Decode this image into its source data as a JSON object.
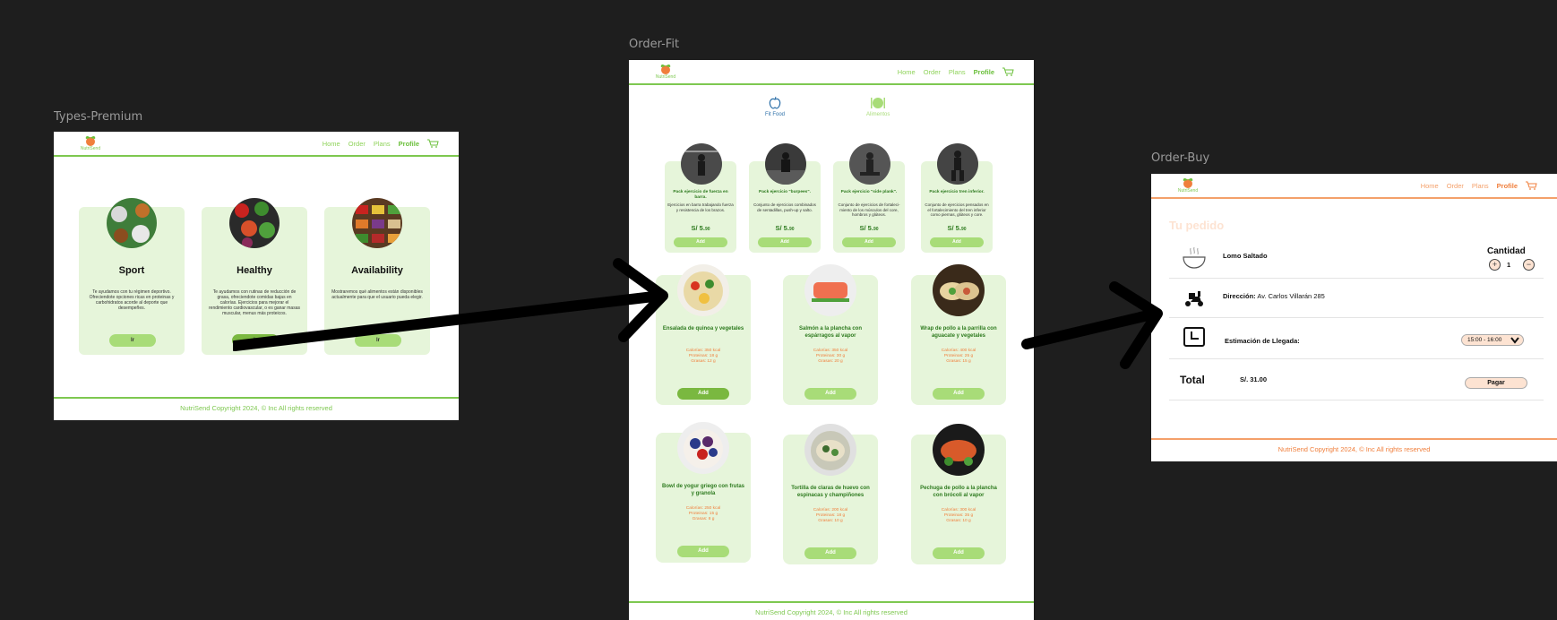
{
  "frames": {
    "types_premium": "Types-Premium",
    "order_fit": "Order-Fit",
    "order_buy": "Order-Buy"
  },
  "nav": {
    "logo": "NutriSend",
    "home": "Home",
    "order": "Order",
    "plans": "Plans",
    "profile": "Profile"
  },
  "footer": "NutriSend Copyright 2024, © Inc All rights reserved",
  "types_premium": {
    "cards": [
      {
        "title": "Sport",
        "desc": "Te ayudamos con tu régimen deportivo. Ofreciendote opciones ricas en proteinas y carbohidratos acorde al deporte que desempeñes.",
        "btn": "Ir"
      },
      {
        "title": "Healthy",
        "desc": "Te ayudamos con rutinas de reducción de grasa, ofreciendote comidas bajas en calorías. Ejercicios para mejorar el rendimiento cardiovascular, o es ganar masas muscular, menus más proteicos.",
        "btn": "Ir"
      },
      {
        "title": "Availability",
        "desc": "Mostraremos qué alimentos están disponibles actualmente para que el usuario pueda elegir.",
        "btn": "Ir"
      }
    ]
  },
  "order_fit": {
    "tabs": [
      {
        "label": "Fit Food"
      },
      {
        "label": "Alimentos"
      }
    ],
    "exercises": [
      {
        "title": "Pack ejercicio de fuerza en barra.",
        "desc": "Ejercicios en barra trabajando fuerza y resistencia de los brazos.",
        "price": "S/ 5.",
        "cents": "90",
        "btn": "Add"
      },
      {
        "title": "Pack ejercicio \"burpees\".",
        "desc": "Conjunto de ejercicios combinados de sentadillas, push-up y salto.",
        "price": "S/ 5.",
        "cents": "90",
        "btn": "Add"
      },
      {
        "title": "Pack ejercicio \"side plank\".",
        "desc": "Conjunto de ejercicios de fortaleci-miento de los músculos del core, hombros y glúteos.",
        "price": "S/ 5.",
        "cents": "90",
        "btn": "Add"
      },
      {
        "title": "Pack ejercicio tren inferior.",
        "desc": "Conjunto de ejercicios pensados en el fortalecimiento del tren inferior como piernas, glúteos y core.",
        "price": "S/ 5.",
        "cents": "90",
        "btn": "Add"
      }
    ],
    "foods": [
      {
        "title": "Ensalada de quinoa y vegetales",
        "cal": "Calorías: 350 kcal",
        "prot": "Proteinas: 18 g",
        "fat": "Grasas: 12 g",
        "btn": "Add",
        "dark": true
      },
      {
        "title": "Salmón a la plancha con espárragos al vapor",
        "cal": "Calorías: 350 kcal",
        "prot": "Proteinas: 30 g",
        "fat": "Grasas: 20 g",
        "btn": "Add",
        "dark": false
      },
      {
        "title": "Wrap de pollo a la parrilla con aguacate y vegetales",
        "cal": "Calorías: 400 kcal",
        "prot": "Proteinas: 25 g",
        "fat": "Grasas: 15 g",
        "btn": "Add",
        "dark": false
      },
      {
        "title": "Bowl de yogur griego con frutas y granola",
        "cal": "Calorías: 250 kcal",
        "prot": "Proteinas: 15 g",
        "fat": "Grasas: 8 g",
        "btn": "Add",
        "dark": false
      },
      {
        "title": "Tortilla de claras de huevo con espinacas y champiñones",
        "cal": "Calorías: 200 kcal",
        "prot": "Proteinas: 18 g",
        "fat": "Grasas: 10 g",
        "btn": "Add",
        "dark": false
      },
      {
        "title": "Pechuga de pollo a la plancha con brócoli al vapor",
        "cal": "Calorías: 300 kcal",
        "prot": "Proteinas: 35 g",
        "fat": "Grasas: 10 g",
        "btn": "Add",
        "dark": false
      }
    ]
  },
  "order_buy": {
    "heading": "Tu pedido",
    "item": "Lomo Saltado",
    "quantity_label": "Cantidad",
    "quantity": "1",
    "address_label": "Dirección:",
    "address": "Av. Carlos Villarán 285",
    "eta_label": "Estimación de Llegada:",
    "eta_value": "15:00 - 16:00",
    "total_label": "Total",
    "total_value": "S/. 31.00",
    "pay": "Pagar"
  },
  "colors": {
    "green": "#7ec850",
    "orange": "#f07f3c",
    "card": "#e6f5da"
  }
}
